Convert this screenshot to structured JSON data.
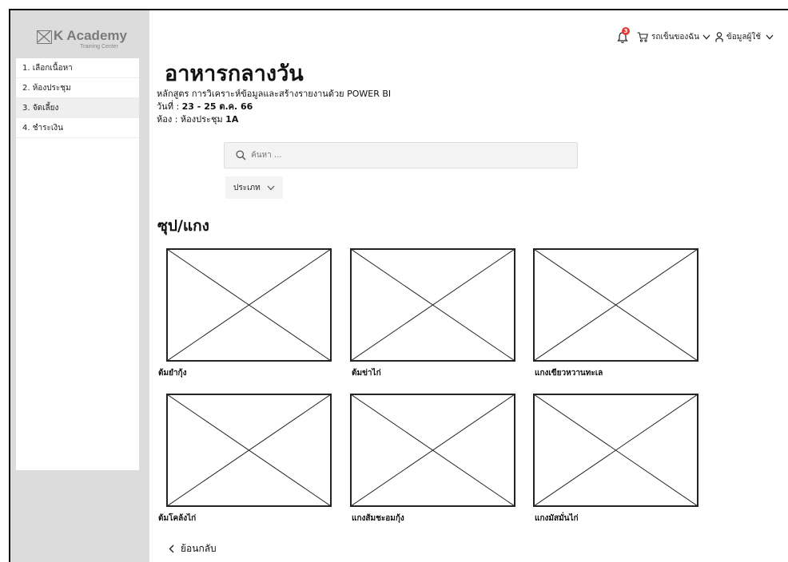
{
  "brand": {
    "title": "K Academy",
    "subtitle": "Training Center",
    "logo_icon": "x-box-logo"
  },
  "sidebar": {
    "items": [
      {
        "label": "1. เลือกเนื้อหา",
        "active": false
      },
      {
        "label": "2. ห้องประชุม",
        "active": false
      },
      {
        "label": "3. จัดเลี้ยง",
        "active": true
      },
      {
        "label": "4. ชำระเงิน",
        "active": false
      }
    ]
  },
  "header": {
    "notification_count": "3",
    "cart_label": "รถเข็นของฉัน",
    "user_label": "ข้อมูลผู้ใช้",
    "badge_color": "#e53935"
  },
  "page": {
    "title": "อาหารกลางวัน",
    "course_line": "หลักสูตร การวิเคราะห์ข้อมูลและสร้างรายงานด้วย POWER BI",
    "date_prefix": "วันที่ : ",
    "date_value": "23 - 25 ต.ค. 66",
    "room_prefix": "ห้อง : ห้องประชุม ",
    "room_value": "1A"
  },
  "search": {
    "placeholder": "ค้นหา ..."
  },
  "filter": {
    "category_label": "ประเภท"
  },
  "section": {
    "title": "ซุป/แกง"
  },
  "items": [
    {
      "label": "ต้มยำกุ้ง"
    },
    {
      "label": "ต้มข่าไก่"
    },
    {
      "label": "แกงเขียวหวานทะเล"
    },
    {
      "label": "ต้มโคล้งไก่"
    },
    {
      "label": "แกงส้มชะอมกุ้ง"
    },
    {
      "label": "แกงมัสมั่นไก่"
    }
  ],
  "footer": {
    "back_label": "ย้อนกลับ"
  }
}
